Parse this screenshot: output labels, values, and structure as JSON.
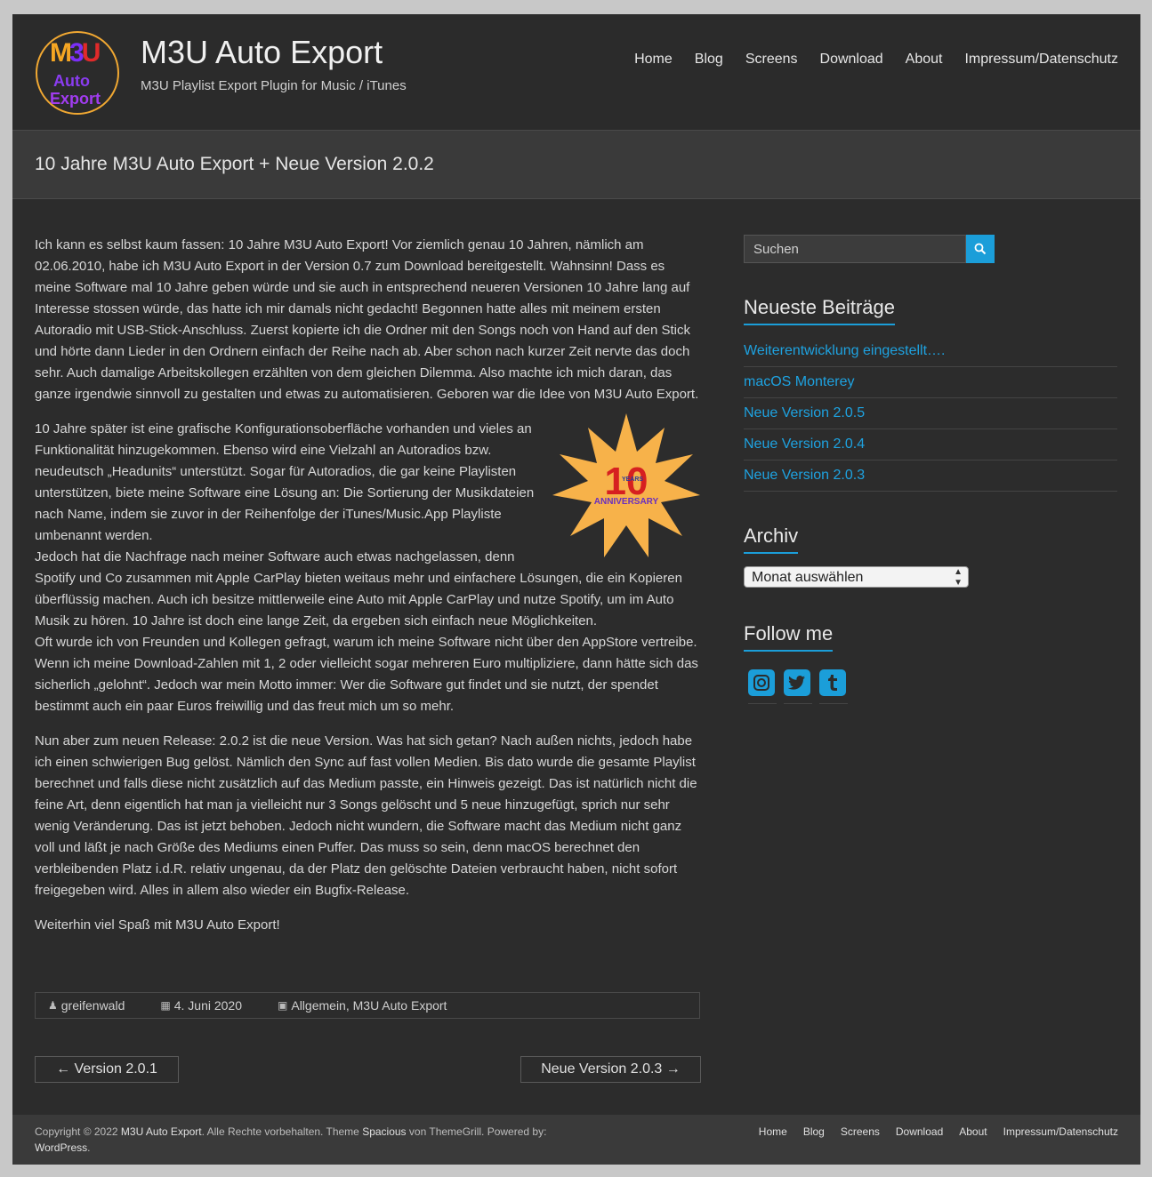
{
  "site": {
    "title": "M3U Auto Export",
    "description": "M3U Playlist Export Plugin for Music / iTunes",
    "logo_top": "M3U",
    "logo_line2": "Auto",
    "logo_line3": "Export"
  },
  "nav": [
    "Home",
    "Blog",
    "Screens",
    "Download",
    "About",
    "Impressum/Datenschutz"
  ],
  "post": {
    "title": "10 Jahre M3U Auto Export + Neue Version 2.0.2",
    "p1": "Ich kann es selbst kaum fassen: 10 Jahre M3U Auto Export! Vor ziemlich genau 10 Jahren, nämlich am 02.06.2010, habe ich M3U Auto Export in der Version 0.7 zum Download bereitgestellt. Wahnsinn! Dass es meine Software mal 10 Jahre geben würde und sie auch in entsprechend neueren Versionen 10 Jahre lang auf Interesse stossen würde, das hatte ich mir damals nicht gedacht! Begonnen hatte alles mit meinem ersten Autoradio mit USB-Stick-Anschluss. Zuerst kopierte ich die Ordner mit den Songs noch von Hand auf den Stick und hörte dann Lieder in den Ordnern einfach der Reihe nach ab. Aber schon nach kurzer Zeit nervte das doch sehr. Auch damalige Arbeitskollegen erzählten von dem gleichen Dilemma. Also machte ich mich daran, das ganze irgendwie sinnvoll zu gestalten und etwas zu automatisieren. Geboren war die Idee von M3U Auto Export.",
    "p2a": "10 Jahre später ist eine grafische Konfigurationsoberfläche vorhanden und vieles an Funktionalität hinzugekommen. Ebenso wird eine Vielzahl an Autoradios bzw. neudeutsch „Headunits“ unterstützt. Sogar für Autoradios, die gar keine Playlisten unterstützen, biete meine Software eine Lösung an: Die Sortierung der Musikdateien nach Name, indem sie zuvor in der Reihenfolge der iTunes/Music.App Playliste umbenannt werden.",
    "p2b": "Jedoch hat die Nachfrage nach meiner Software auch etwas nachgelassen, denn Spotify und Co zusammen mit Apple CarPlay bieten weitaus mehr und einfachere Lösungen, die ein Kopieren überflüssig machen. Auch ich besitze mittlerweile eine Auto mit Apple CarPlay und nutze Spotify, um im Auto Musik zu hören. 10 Jahre ist doch eine lange Zeit, da ergeben sich einfach neue Möglichkeiten.",
    "p2c": "Oft wurde ich von Freunden und Kollegen gefragt, warum ich meine Software nicht über den AppStore vertreibe. Wenn ich meine Download-Zahlen mit 1, 2 oder vielleicht sogar mehreren Euro multipliziere, dann hätte sich das sicherlich „gelohnt“. Jedoch war mein Motto immer: Wer die Software gut findet und sie nutzt, der spendet bestimmt auch ein paar Euros freiwillig und das freut mich um so mehr.",
    "p3": "Nun aber zum neuen Release: 2.0.2 ist die neue Version. Was hat sich getan? Nach außen nichts, jedoch habe ich einen schwierigen Bug gelöst. Nämlich den Sync auf fast vollen Medien. Bis dato wurde die gesamte Playlist berechnet und falls diese nicht zusätzlich auf das Medium passte, ein Hinweis gezeigt. Das ist natürlich nicht die feine Art, denn eigentlich hat man ja vielleicht nur 3 Songs gelöscht und 5 neue hinzugefügt, sprich nur sehr wenig Veränderung. Das ist jetzt behoben. Jedoch nicht wundern, die Software macht das Medium nicht ganz voll und läßt je nach Größe des Mediums einen Puffer. Das muss so sein, denn macOS berechnet den verbleibenden Platz i.d.R. relativ ungenau, da der Platz den gelöschte Dateien verbraucht haben, nicht sofort freigegeben wird. Alles in allem also wieder ein Bugfix-Release.",
    "p4": "Weiterhin viel Spaß mit M3U Auto Export!",
    "badge_number": "10",
    "badge_years": "YEARS",
    "badge_anniversary": "ANNIVERSARY",
    "author": "greifenwald",
    "date": "4. Juni 2020",
    "categories": "Allgemein, M3U Auto Export",
    "prev": "← Version 2.0.1",
    "next": "Neue Version 2.0.3 →"
  },
  "sidebar": {
    "search_placeholder": "Suchen",
    "recent_title": "Neueste Beiträge",
    "recent": [
      "Weiterentwicklung eingestellt….",
      "macOS Monterey",
      "Neue Version 2.0.5",
      "Neue Version 2.0.4",
      "Neue Version 2.0.3"
    ],
    "archive_title": "Archiv",
    "archive_select": "Monat auswählen",
    "follow_title": "Follow me",
    "social_icons": [
      "instagram-icon",
      "twitter-icon",
      "tumblr-icon"
    ]
  },
  "footer": {
    "copyright_prefix": "Copyright © 2022",
    "site_link": "M3U Auto Export",
    "rights": ". Alle Rechte vorbehalten. Theme",
    "theme": "Spacious",
    "by": "von ThemeGrill. Powered by:",
    "powered": "WordPress",
    "end": ".",
    "nav": [
      "Home",
      "Blog",
      "Screens",
      "Download",
      "About",
      "Impressum/Datenschutz"
    ]
  },
  "colors": {
    "accent": "#1b9ed9",
    "background": "#2c2c2c",
    "titlebar": "#3a3a3a"
  }
}
